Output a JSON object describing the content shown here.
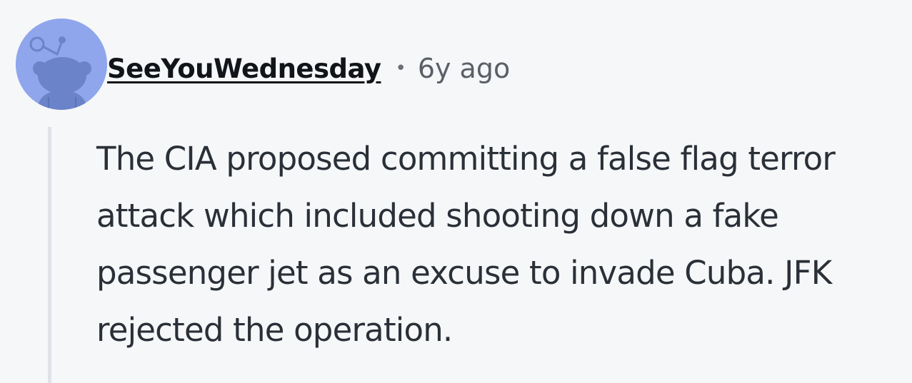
{
  "comment": {
    "author": "SeeYouWednesday",
    "separator": "•",
    "timestamp": "6y ago",
    "avatar_icon": "snoo-avatar-icon",
    "body": "The CIA proposed committing a false flag terror attack which included shooting down a fake passenger jet as an excuse to invade Cuba. JFK rejected the operation."
  },
  "colors": {
    "background": "#f6f7f9",
    "avatar_bg": "#8fa6ec",
    "avatar_figure": "#6a83c9",
    "thread_line": "#dfe2e6",
    "text": "#2a3038",
    "muted": "#5a6068"
  }
}
